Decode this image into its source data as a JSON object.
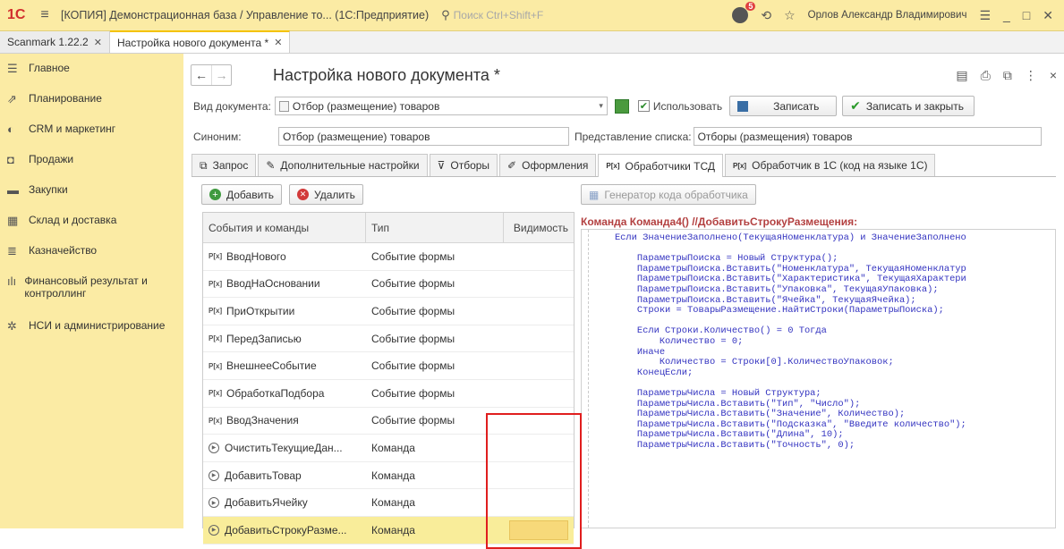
{
  "titlebar": {
    "logo": "1С",
    "title": "[КОПИЯ] Демонстрационная база / Управление то... (1С:Предприятие)",
    "search_placeholder": "Поиск Ctrl+Shift+F",
    "notifications": "5",
    "user": "Орлов Александр Владимирович"
  },
  "doctabs": [
    {
      "label": "Scanmark 1.22.2"
    },
    {
      "label": "Настройка нового документа *"
    }
  ],
  "sidebar": [
    {
      "label": "Главное",
      "icon": "menu-icon"
    },
    {
      "label": "Планирование",
      "icon": "chart-icon"
    },
    {
      "label": "CRM и маркетинг",
      "icon": "crm-icon"
    },
    {
      "label": "Продажи",
      "icon": "bag-icon"
    },
    {
      "label": "Закупки",
      "icon": "cart-icon"
    },
    {
      "label": "Склад и доставка",
      "icon": "warehouse-icon"
    },
    {
      "label": "Казначейство",
      "icon": "coins-icon"
    },
    {
      "label": "Финансовый результат и контроллинг",
      "icon": "bars-icon"
    },
    {
      "label": "НСИ и администрирование",
      "icon": "gear-icon"
    }
  ],
  "form": {
    "title": "Настройка нового документа *",
    "doc_type_label": "Вид документа:",
    "doc_type_value": "Отбор (размещение) товаров",
    "use_label": "Использовать",
    "save_label": "Записать",
    "save_close_label": "Записать и закрыть",
    "synonym_label": "Синоним:",
    "synonym_value": "Отбор (размещение) товаров",
    "list_repr_label": "Представление списка:",
    "list_repr_value": "Отборы (размещения) товаров"
  },
  "tabs": [
    {
      "label": "Запрос"
    },
    {
      "label": "Дополнительные настройки"
    },
    {
      "label": "Отборы"
    },
    {
      "label": "Оформления"
    },
    {
      "label": "Обработчики ТСД"
    },
    {
      "label": "Обработчик в 1С (код на языке 1С)"
    }
  ],
  "events": {
    "add_label": "Добавить",
    "delete_label": "Удалить",
    "columns": [
      "События и команды",
      "Тип",
      "Видимость"
    ],
    "rows": [
      {
        "name": "ВводНового",
        "type": "Событие формы",
        "kind": "event"
      },
      {
        "name": "ВводНаОсновании",
        "type": "Событие формы",
        "kind": "event"
      },
      {
        "name": "ПриОткрытии",
        "type": "Событие формы",
        "kind": "event"
      },
      {
        "name": "ПередЗаписью",
        "type": "Событие формы",
        "kind": "event"
      },
      {
        "name": "ВнешнееСобытие",
        "type": "Событие формы",
        "kind": "event"
      },
      {
        "name": "ОбработкаПодбора",
        "type": "Событие формы",
        "kind": "event"
      },
      {
        "name": "ВводЗначения",
        "type": "Событие формы",
        "kind": "event"
      },
      {
        "name": "ОчиститьТекущиеДан...",
        "type": "Команда",
        "kind": "command"
      },
      {
        "name": "ДобавитьТовар",
        "type": "Команда",
        "kind": "command"
      },
      {
        "name": "ДобавитьЯчейку",
        "type": "Команда",
        "kind": "command"
      },
      {
        "name": "ДобавитьСтрокуРазме...",
        "type": "Команда",
        "kind": "command"
      }
    ]
  },
  "codepanel": {
    "generator_label": "Генератор кода обработчика",
    "command_title": "Команда Команда4() //ДобавитьСтрокуРазмещения:",
    "code": "    Если ЗначениеЗаполнено(ТекущаяНоменклатура) и ЗначениеЗаполнено\n\n        ПараметрыПоиска = Новый Структура();\n        ПараметрыПоиска.Вставить(\"Номенклатура\", ТекущаяНоменклатур\n        ПараметрыПоиска.Вставить(\"Характеристика\", ТекущаяХарактери\n        ПараметрыПоиска.Вставить(\"Упаковка\", ТекущаяУпаковка);\n        ПараметрыПоиска.Вставить(\"Ячейка\", ТекущаяЯчейка);\n        Строки = ТоварыРазмещение.НайтиСтроки(ПараметрыПоиска);\n\n        Если Строки.Количество() = 0 Тогда\n            Количество = 0;\n        Иначе\n            Количество = Строки[0].КоличествоУпаковок;\n        КонецЕсли;\n\n        ПараметрыЧисла = Новый Структура;\n        ПараметрыЧисла.Вставить(\"Тип\", \"Число\");\n        ПараметрыЧисла.Вставить(\"Значение\", Количество);\n        ПараметрыЧисла.Вставить(\"Подсказка\", \"Введите количество\");\n        ПараметрыЧисла.Вставить(\"Длина\", 10);\n        ПараметрыЧисла.Вставить(\"Точность\", 0);"
  }
}
